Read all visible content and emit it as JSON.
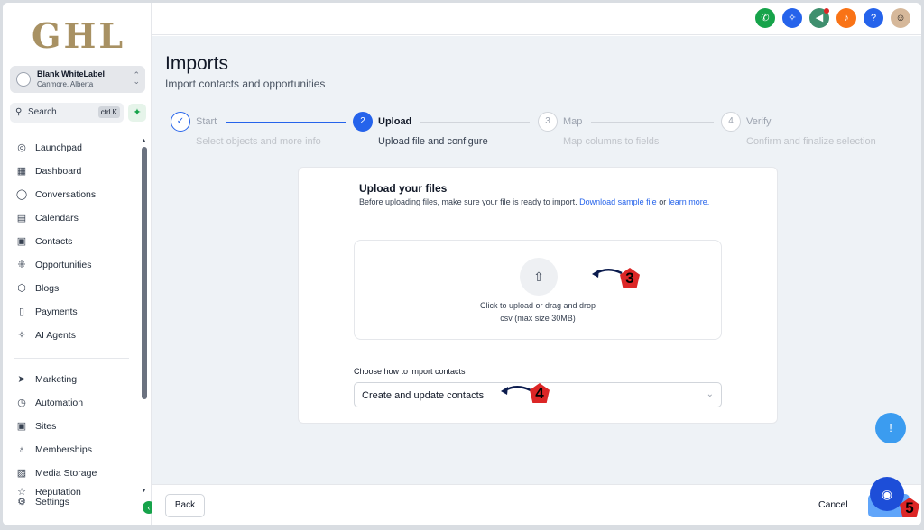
{
  "brand": {
    "logo_text": "GHL"
  },
  "account": {
    "name": "Blank WhiteLabel",
    "location": "Canmore, Alberta"
  },
  "search": {
    "label": "Search",
    "shortcut": "ctrl K"
  },
  "sidebar": {
    "items": [
      {
        "label": "Launchpad",
        "icon": "rocket-icon"
      },
      {
        "label": "Dashboard",
        "icon": "grid-icon"
      },
      {
        "label": "Conversations",
        "icon": "chat-icon"
      },
      {
        "label": "Calendars",
        "icon": "calendar-icon"
      },
      {
        "label": "Contacts",
        "icon": "contacts-icon"
      },
      {
        "label": "Opportunities",
        "icon": "opportunities-icon"
      },
      {
        "label": "Blogs",
        "icon": "cube-icon"
      },
      {
        "label": "Payments",
        "icon": "payments-icon"
      },
      {
        "label": "AI Agents",
        "icon": "sparkle-icon"
      }
    ],
    "items2": [
      {
        "label": "Marketing",
        "icon": "send-icon"
      },
      {
        "label": "Automation",
        "icon": "automation-icon"
      },
      {
        "label": "Sites",
        "icon": "sites-icon"
      },
      {
        "label": "Memberships",
        "icon": "membership-icon"
      },
      {
        "label": "Media Storage",
        "icon": "image-icon"
      },
      {
        "label": "Reputation",
        "icon": "star-icon"
      },
      {
        "label": "Settings",
        "icon": "gear-icon"
      }
    ]
  },
  "topbar": {
    "icons": [
      "phone-icon",
      "magic-icon",
      "megaphone-icon",
      "bell-icon",
      "help-icon",
      "user-avatar"
    ]
  },
  "page": {
    "title": "Imports",
    "subtitle": "Import contacts and opportunities"
  },
  "steps": [
    {
      "number": "✓",
      "label": "Start",
      "desc": "Select objects and more info",
      "state": "done"
    },
    {
      "number": "2",
      "label": "Upload",
      "desc": "Upload file and configure",
      "state": "active"
    },
    {
      "number": "3",
      "label": "Map",
      "desc": "Map columns to fields",
      "state": "pending"
    },
    {
      "number": "4",
      "label": "Verify",
      "desc": "Confirm and finalize selection",
      "state": "pending"
    }
  ],
  "upload": {
    "heading": "Upload your files",
    "note_prefix": "Before uploading files, make sure your file is ready to import.",
    "sample_link": "Download sample file",
    "note_mid": "or",
    "learn_link": "learn more.",
    "drop_text": "Click to upload or drag and drop",
    "drop_hint": "csv (max size 30MB)",
    "choose_label": "Choose how to import contacts",
    "choose_value": "Create and update contacts"
  },
  "footer": {
    "back_label": "Back",
    "cancel_label": "Cancel"
  },
  "annotations": [
    "3",
    "4",
    "5"
  ],
  "colors": {
    "primary": "#2563eb",
    "brand_gold": "#a89163",
    "annotation": "#dc2626"
  }
}
